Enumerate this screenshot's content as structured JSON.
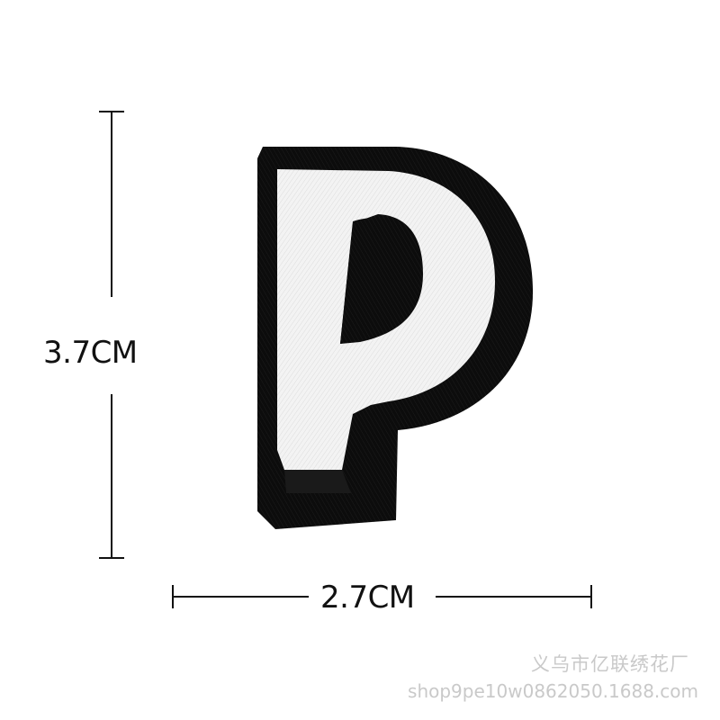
{
  "product_photo": {
    "subject": "embroidered letter patch",
    "letter": "P",
    "colors": {
      "border": "#0a0a0a",
      "face": "#f2f2f2",
      "background": "#ffffff",
      "dimension_lines": "#111111"
    }
  },
  "dimensions": {
    "height_label": "3.7CM",
    "width_label": "2.7CM"
  },
  "watermark": {
    "factory_name": "义乌市亿联绣花厂",
    "shop_url": "shop9pe10w0862050.1688.com"
  }
}
